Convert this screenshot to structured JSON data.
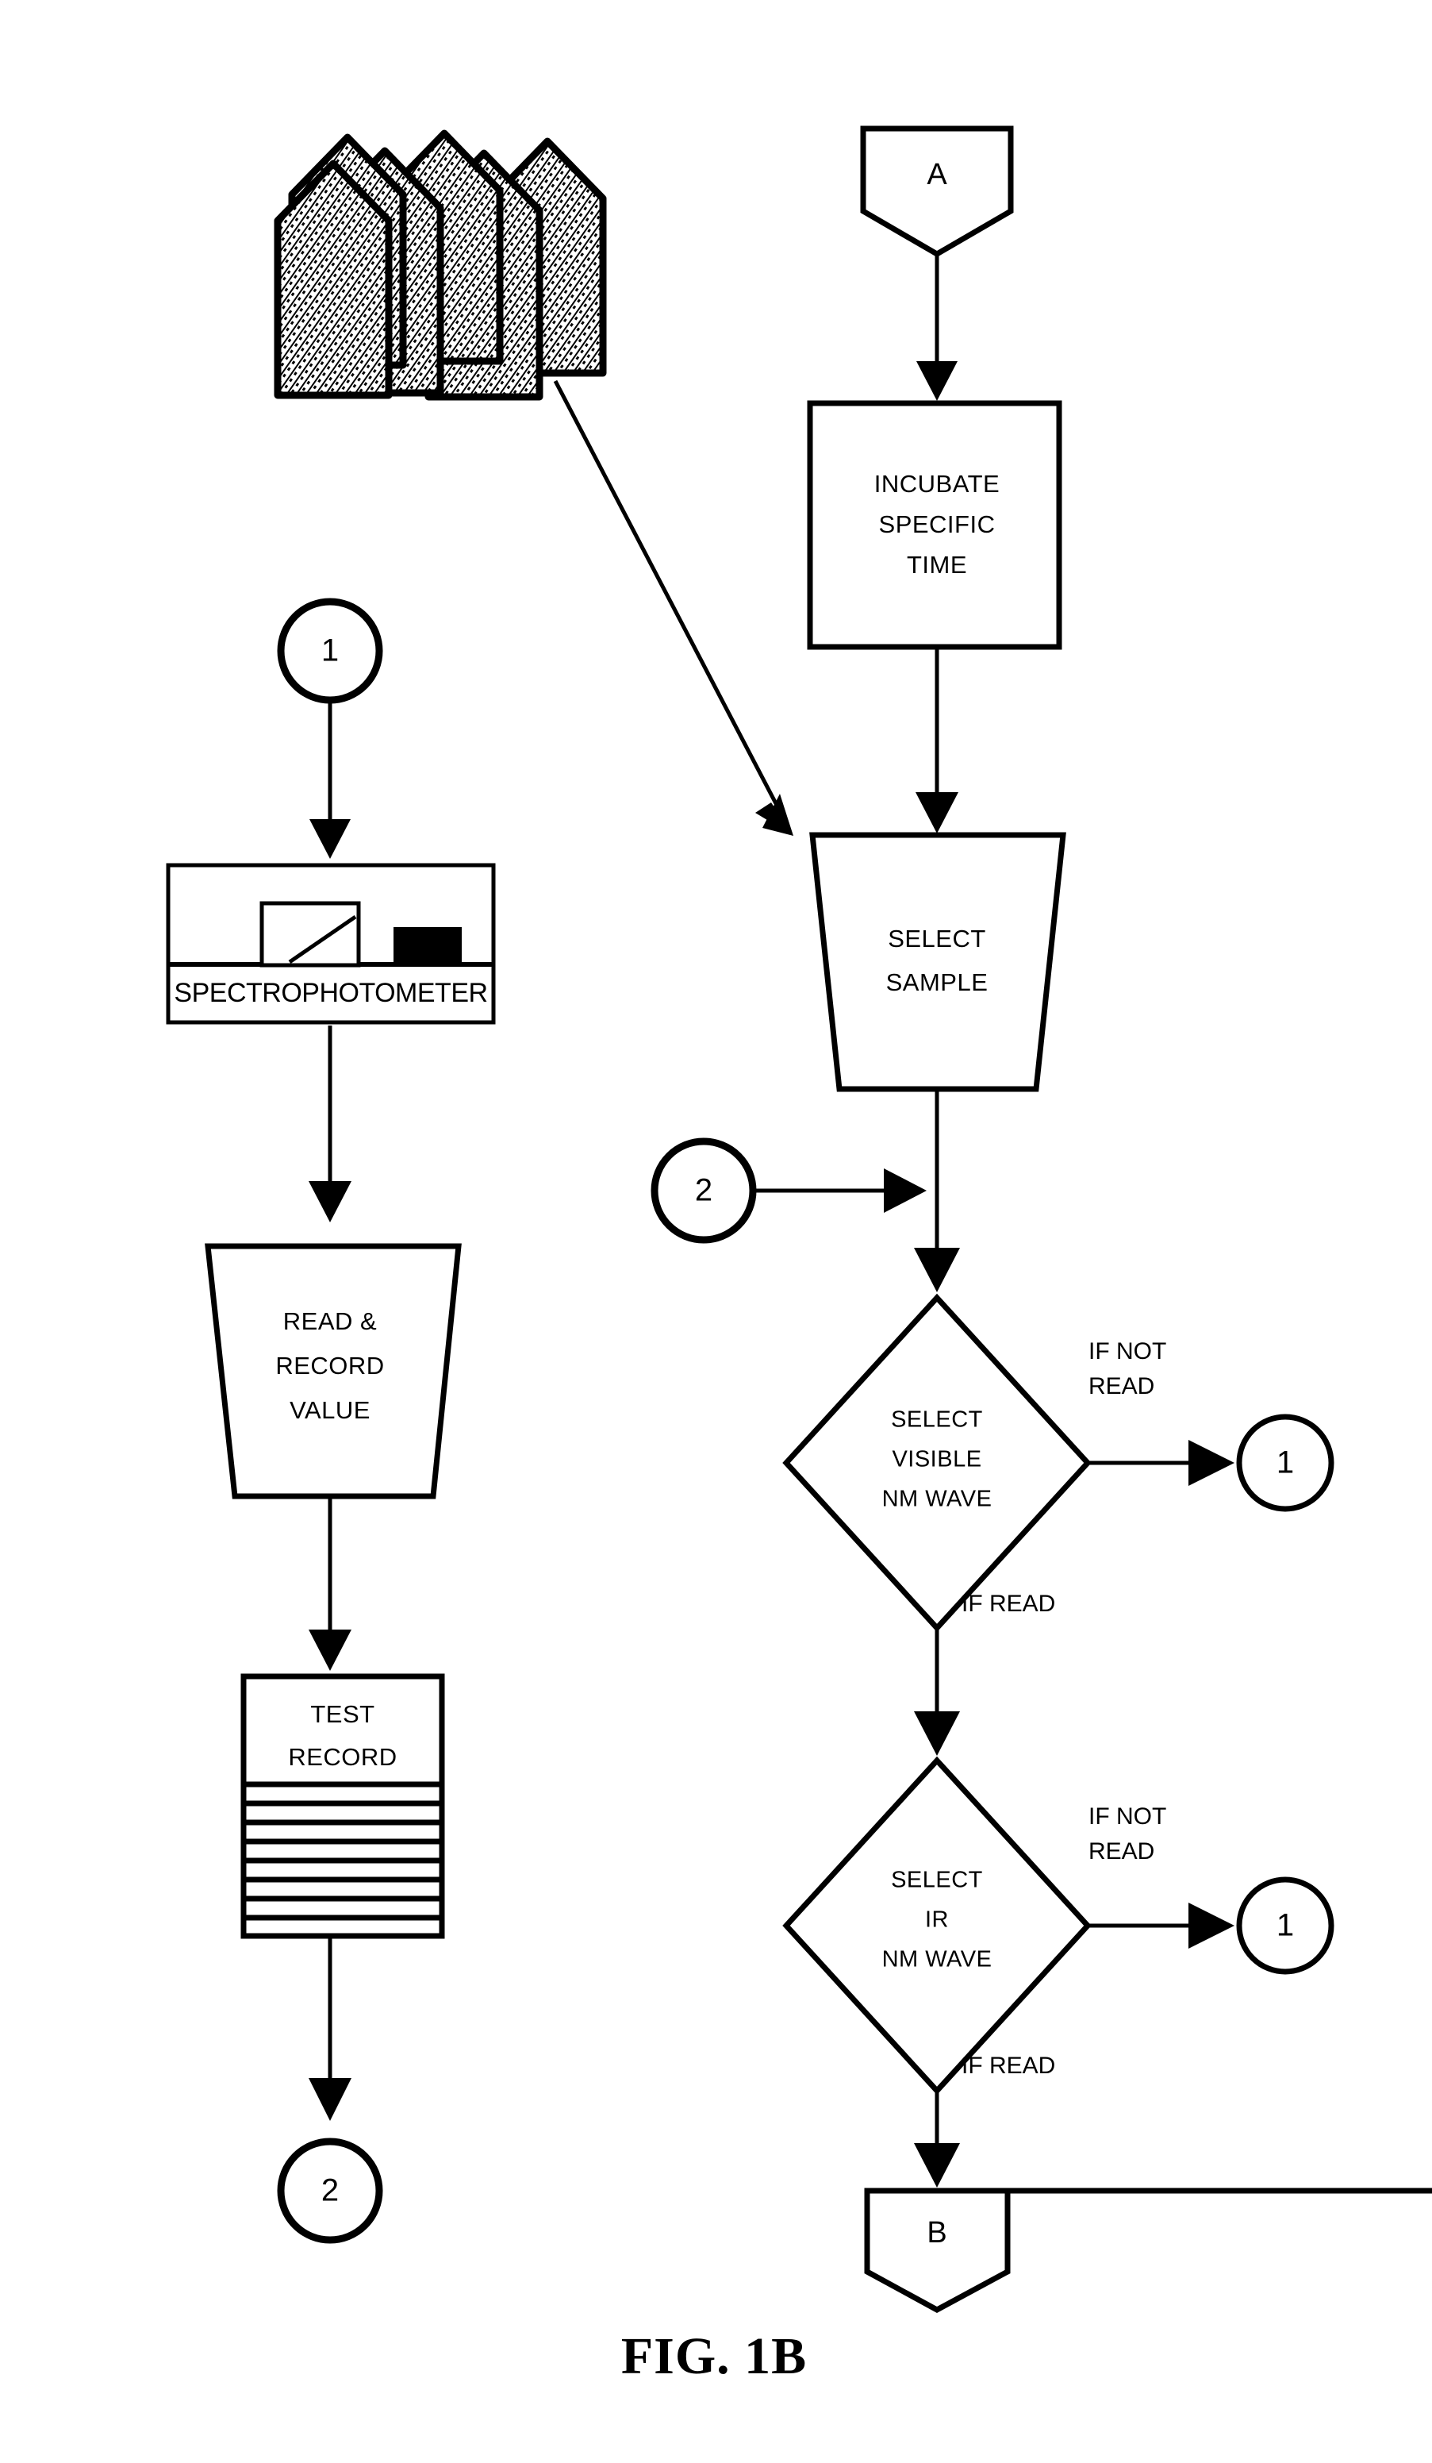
{
  "figure": {
    "caption": "FIG. 1B",
    "title": "FIG. 1B"
  },
  "colors": {
    "ink": "#000000",
    "paper": "#ffffff",
    "hatch": "#000000"
  },
  "graphics": {
    "buildings": {
      "name": "hatched-buildings-cluster",
      "count": 6,
      "fill_pattern": "diagonal-hatch"
    }
  },
  "left_column": {
    "connector_in": {
      "label": "1",
      "shape": "circle"
    },
    "device": {
      "label": "SPECTROPHOTOMETER",
      "shape": "device-box",
      "has_display": true,
      "has_keypad": true
    },
    "process": {
      "shape": "trapezoid",
      "lines": [
        "READ &",
        "RECORD",
        "VALUE"
      ]
    },
    "document": {
      "shape": "ruled-document",
      "lines": [
        "TEST",
        "RECORD"
      ],
      "rule_count": 8
    },
    "connector_out": {
      "label": "2",
      "shape": "circle"
    }
  },
  "right_column": {
    "connector_in": {
      "label": "A",
      "shape": "pentagon-down"
    },
    "incubate": {
      "shape": "rectangle",
      "lines": [
        "INCUBATE",
        "SPECIFIC",
        "TIME"
      ]
    },
    "select_sample": {
      "shape": "trapezoid",
      "lines": [
        "SELECT",
        "SAMPLE"
      ]
    },
    "merge_connector": {
      "label": "2",
      "shape": "circle"
    },
    "decision_visible": {
      "shape": "diamond",
      "lines": [
        "SELECT",
        "VISIBLE",
        "NM WAVE"
      ],
      "branch_no": {
        "lines": [
          "IF NOT",
          "READ"
        ],
        "target": "1"
      },
      "branch_yes": {
        "label": "IF READ"
      }
    },
    "decision_ir": {
      "shape": "diamond",
      "lines": [
        "SELECT",
        "IR",
        "NM WAVE"
      ],
      "branch_no": {
        "lines": [
          "IF NOT",
          "READ"
        ],
        "target": "1"
      },
      "branch_yes": {
        "label": "IF READ"
      }
    },
    "connector_out": {
      "label": "B",
      "shape": "pentagon-down"
    }
  }
}
